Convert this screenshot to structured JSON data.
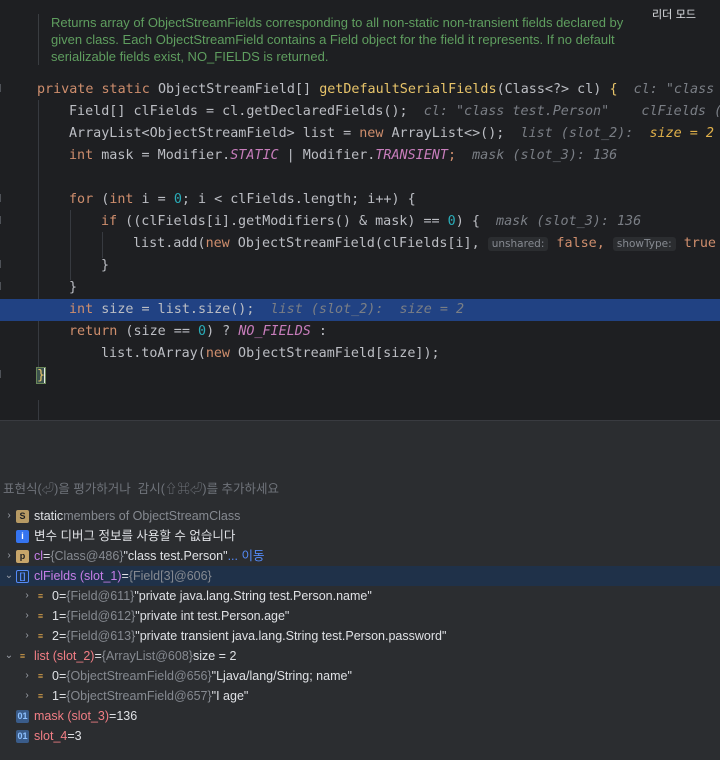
{
  "editor": {
    "reader_mode": "리더 모드",
    "doc_comment": [
      "Returns array of ObjectStreamFields corresponding to all non-static non-transient fields declared by",
      "given class. Each ObjectStreamField contains a Field object for the field it represents. If no default",
      "serializable fields exist, NO_FIELDS is returned."
    ],
    "lines": {
      "l1_kw": "private static ",
      "l1_type": "ObjectStreamField[] ",
      "l1_fn": "getDefaultSerialFields",
      "l1_args": "(Class<?> cl) ",
      "l1_brace": "{",
      "l1_inl": "  cl: \"class",
      "l2_code": "Field[] clFields = cl.getDeclaredFields();",
      "l2_inl": "  cl: \"class test.Person\"    clFields (",
      "l3_a": "ArrayList<ObjectStreamField> list = ",
      "l3_new": "new",
      "l3_b": " ArrayList<>();",
      "l3_inl": "  list (slot_2):",
      "l3_inlY": "  size = 2",
      "l4_kw": "int",
      "l4_a": " mask = Modifier.",
      "l4_c1": "STATIC",
      "l4_b": " | Modifier.",
      "l4_c2": "TRANSIENT",
      "l4_semi": ";",
      "l4_inl": "  mask (slot_3): 136",
      "l5_kw": "for",
      "l5_a": " (",
      "l5_int": "int",
      "l5_b": " i = ",
      "l5_zero": "0",
      "l5_c": "; i < clFields.length; i++) {",
      "l6_kw": "if",
      "l6_a": " ((clFields[i].getModifiers() & mask) == ",
      "l6_zero": "0",
      "l6_b": ") {",
      "l6_inl": "  mask (slot_3): 136",
      "l7_a": "list.add(",
      "l7_new": "new",
      "l7_b": " ObjectStreamField(clFields[i], ",
      "l7_hint1": "unshared:",
      "l7_false": " false",
      "l7_comma": ", ",
      "l7_hint2": "showType:",
      "l7_true": " true",
      "l8": "}",
      "l9": "}",
      "l10_kw": "int",
      "l10_a": " size = list.size();",
      "l10_inl": "  list (slot_2):  size = 2",
      "l11_kw": "return",
      "l11_a": " (size == ",
      "l11_zero": "0",
      "l11_b": ") ? ",
      "l11_c": "NO_FIELDS",
      "l11_d": " :",
      "l12_a": "list.toArray(",
      "l12_new": "new",
      "l12_b": " ObjectStreamField[size]);",
      "l13": "}"
    }
  },
  "debugger": {
    "eval_placeholder": "표현식(⏎)을 평가하거나  감시(⇧⌘⏎)를 추가하세요",
    "rows": [
      {
        "chev": "›",
        "icon": "S",
        "name": "static",
        "rest": " members of ObjectStreamClass"
      },
      {
        "chev": "",
        "icon": "i",
        "name": "변수 디버그 정보를 사용할 수 없습니다",
        "rest": ""
      },
      {
        "chev": "›",
        "icon": "p",
        "name": "cl",
        "eq": " = ",
        "type": "{Class@486}",
        "val": " \"class test.Person\"",
        "link": " ... 이동"
      },
      {
        "chev": "⌄",
        "icon": "[]",
        "name": "clFields (slot_1)",
        "eq": " = ",
        "type": "{Field[3]@606}",
        "val": ""
      },
      {
        "chev": "›",
        "icon": "≡",
        "name": "0",
        "eq": " = ",
        "type": "{Field@611}",
        "val": " \"private java.lang.String test.Person.name\""
      },
      {
        "chev": "›",
        "icon": "≡",
        "name": "1",
        "eq": " = ",
        "type": "{Field@612}",
        "val": " \"private int test.Person.age\""
      },
      {
        "chev": "›",
        "icon": "≡",
        "name": "2",
        "eq": " = ",
        "type": "{Field@613}",
        "val": " \"private transient java.lang.String test.Person.password\""
      },
      {
        "chev": "⌄",
        "icon": "≡",
        "name": "list (slot_2)",
        "eq": " = ",
        "type": "{ArrayList@608}",
        "val": "  size = 2"
      },
      {
        "chev": "›",
        "icon": "≡",
        "name": "0",
        "eq": " = ",
        "type": "{ObjectStreamField@656}",
        "val": " \"Ljava/lang/String; name\""
      },
      {
        "chev": "›",
        "icon": "≡",
        "name": "1",
        "eq": " = ",
        "type": "{ObjectStreamField@657}",
        "val": " \"I age\""
      },
      {
        "chev": "",
        "icon": "01",
        "name": "mask (slot_3)",
        "eq": " = ",
        "type": "",
        "val": "136"
      },
      {
        "chev": "",
        "icon": "01",
        "name": "slot_4",
        "eq": " = ",
        "type": "",
        "val": "3"
      }
    ]
  }
}
